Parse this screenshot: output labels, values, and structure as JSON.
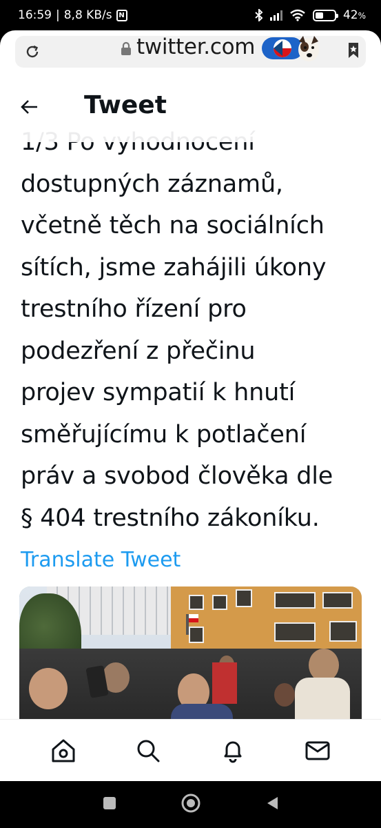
{
  "status": {
    "time": "16:59",
    "speed": "8,8 KB/s",
    "nfc": "N",
    "battery": "42",
    "battery_suffix": "%",
    "battery_level": 0.42
  },
  "browser": {
    "url": "twitter.com",
    "icons": [
      "reload-icon",
      "lock-icon",
      "flag-avatar-badge",
      "bookmark-icon"
    ]
  },
  "header": {
    "title": "Tweet"
  },
  "tweet": {
    "lines": [
      "1/3 Po vyhodnocení",
      "dostupných záznamů,",
      "včetně těch na sociálních",
      "sítích, jsme zahájili úkony",
      "trestního řízení pro",
      "podezření z přečinu",
      "projev sympatií k hnutí",
      "směřujícímu k potlačení",
      "práv a svobod člověka dle",
      "§ 404 trestního zákoníku."
    ],
    "translate_label": "Translate Tweet"
  },
  "bottom_nav": {
    "items": [
      "home-icon",
      "search-icon",
      "notifications-icon",
      "messages-icon"
    ]
  },
  "colors": {
    "accent": "#1d9bf0",
    "text": "#0f1419"
  }
}
